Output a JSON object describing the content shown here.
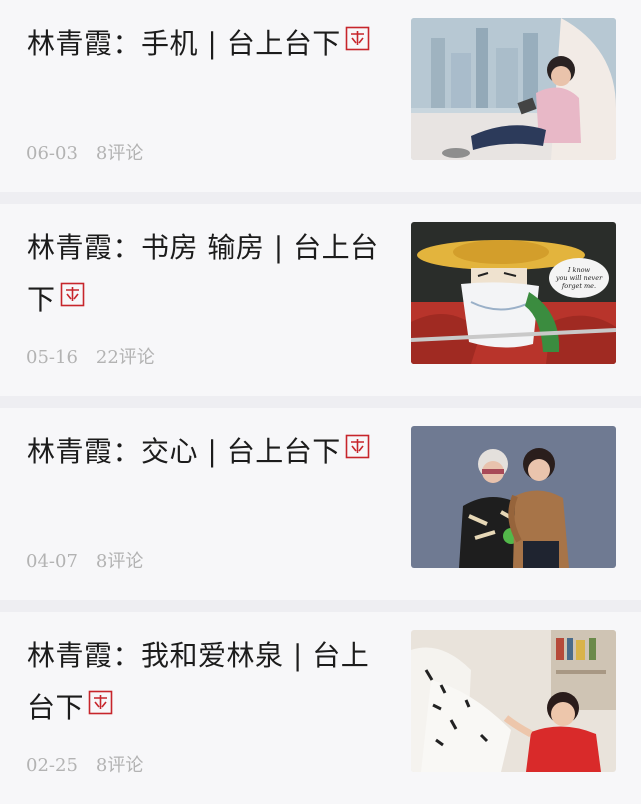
{
  "articles": [
    {
      "title_main": "林青霞：手机 | 台上台下",
      "date": "06-03",
      "comments": "8评论",
      "thumb_icon": "woman-reading-by-window-photo"
    },
    {
      "title_main": "林青霞：书房 输房 | 台上台下",
      "date": "05-16",
      "comments": "22评论",
      "thumb_icon": "swordsman-illustration",
      "thumb_caption": "I know you will never forget me."
    },
    {
      "title_main": "林青霞：交心 | 台上台下",
      "date": "04-07",
      "comments": "8评论",
      "thumb_icon": "two-women-portrait-photo"
    },
    {
      "title_main": "林青霞：我和爱林泉 | 台上台下",
      "date": "02-25",
      "comments": "8评论",
      "thumb_icon": "woman-with-calligraphy-photo"
    }
  ],
  "colors": {
    "stamp_red": "#c7252b",
    "background": "#f7f7f9",
    "title": "#1c1c1c",
    "meta": "#b3b3b3"
  }
}
